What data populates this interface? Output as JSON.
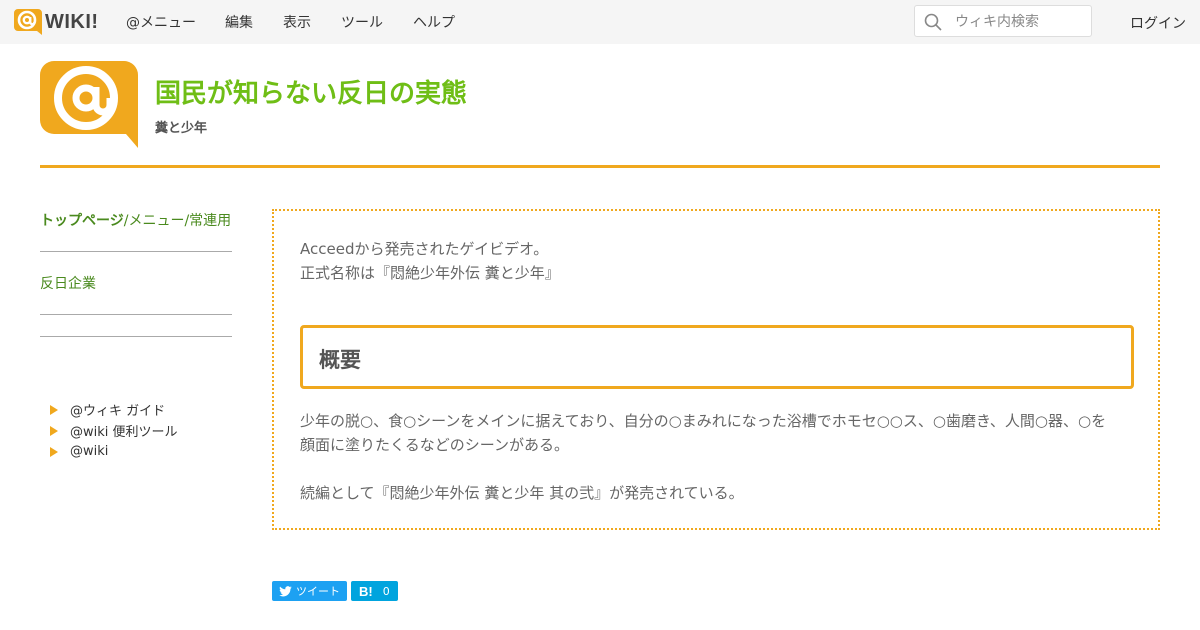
{
  "topbar": {
    "logo_text": "WIKI!",
    "menu": [
      {
        "label": "@メニュー"
      },
      {
        "label": "編集"
      },
      {
        "label": "表示"
      },
      {
        "label": "ツール"
      },
      {
        "label": "ヘルプ"
      }
    ],
    "search_placeholder": "ウィキ内検索",
    "login_label": "ログイン"
  },
  "header": {
    "title": "国民が知らない反日の実態",
    "subtitle": "糞と少年"
  },
  "sidebar": {
    "top_link_main": "トップページ",
    "top_link_rest": "/メニュー/常連用",
    "link": "反日企業",
    "guide_items": [
      {
        "label": "@ウィキ ガイド"
      },
      {
        "label": "@wiki 便利ツール"
      },
      {
        "label": "@wiki"
      }
    ]
  },
  "main": {
    "intro_line1": "Acceedから発売されたゲイビデオ。",
    "intro_line2": "正式名称は『悶絶少年外伝 糞と少年』",
    "section_heading": "概要",
    "body_line1": "少年の脱○、食○シーンをメインに据えており、自分の○まみれになった浴槽でホモセ○○ス、○歯磨き、人間○器、○を",
    "body_line2": "顔面に塗りたくるなどのシーンがある。",
    "body_line3": "続編として『悶絶少年外伝 糞と少年 其の弐』が発売されている。"
  },
  "share": {
    "tweet_label": "ツイート",
    "hatena_mark": "B!",
    "hatena_count": "0"
  },
  "colors": {
    "accent": "#f0a81e",
    "title_green": "#6fbe16",
    "link_green": "#4a8a1e",
    "twitter": "#1da1f2",
    "hatena": "#00a4de"
  }
}
